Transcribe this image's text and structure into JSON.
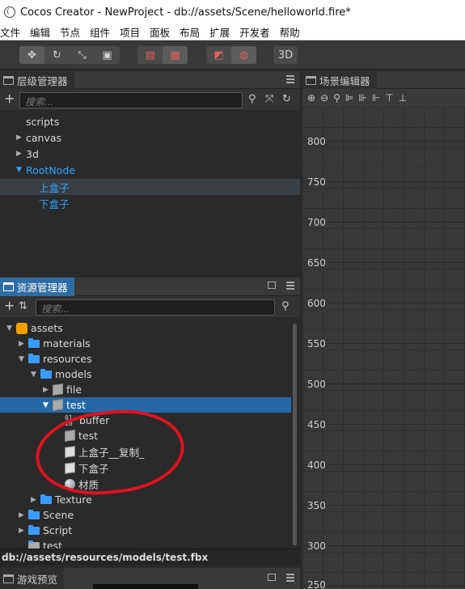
{
  "window": {
    "title": "Cocos Creator - NewProject - db://assets/Scene/helloworld.fire*"
  },
  "menu": [
    "文件",
    "编辑",
    "节点",
    "组件",
    "项目",
    "面板",
    "布局",
    "扩展",
    "开发者",
    "帮助"
  ],
  "toolbar": {
    "group1": [
      "move-icon",
      "rotate-icon",
      "scale-icon",
      "rect-icon"
    ],
    "group2": [
      "pivot-icon",
      "center-icon"
    ],
    "group3": [
      "local-icon",
      "global-icon"
    ],
    "mode_3d_label": "3D"
  },
  "hierarchy": {
    "tab_label": "层级管理器",
    "search_placeholder": "搜索...",
    "nodes": [
      {
        "label": "scripts",
        "arrow": ""
      },
      {
        "label": "canvas",
        "arrow": "▶"
      },
      {
        "label": "3d",
        "arrow": "▶"
      },
      {
        "label": "RootNode",
        "arrow": "▼"
      },
      {
        "label": "上盒子",
        "arrow": ""
      },
      {
        "label": "下盒子",
        "arrow": ""
      }
    ]
  },
  "assets": {
    "tab_label": "资源管理器",
    "search_placeholder": "搜索...",
    "items": [
      {
        "label": "assets",
        "arrow": "▼"
      },
      {
        "label": "materials",
        "arrow": "▶"
      },
      {
        "label": "resources",
        "arrow": "▼"
      },
      {
        "label": "models",
        "arrow": "▼"
      },
      {
        "label": "file",
        "arrow": "▶"
      },
      {
        "label": "test",
        "arrow": "▼"
      },
      {
        "label": "buffer",
        "arrow": ""
      },
      {
        "label": "test",
        "arrow": ""
      },
      {
        "label": "上盒子__复制_",
        "arrow": ""
      },
      {
        "label": "下盒子",
        "arrow": ""
      },
      {
        "label": "材质",
        "arrow": ""
      },
      {
        "label": "Texture",
        "arrow": "▶"
      },
      {
        "label": "Scene",
        "arrow": "▶"
      },
      {
        "label": "Script",
        "arrow": "▶"
      },
      {
        "label": "test",
        "arrow": ""
      }
    ],
    "selected_path": "db://assets/resources/models/test.fbx"
  },
  "game_preview": {
    "tab_label": "游戏预览"
  },
  "scene_editor": {
    "tab_label": "场景编辑器",
    "y_labels": [
      "800",
      "750",
      "700",
      "650",
      "600",
      "550",
      "500",
      "450",
      "400",
      "350",
      "300",
      "250"
    ]
  },
  "colors": {
    "accent": "#2fa3ff",
    "selection": "#2469a6",
    "annotation": "#e0121f"
  }
}
